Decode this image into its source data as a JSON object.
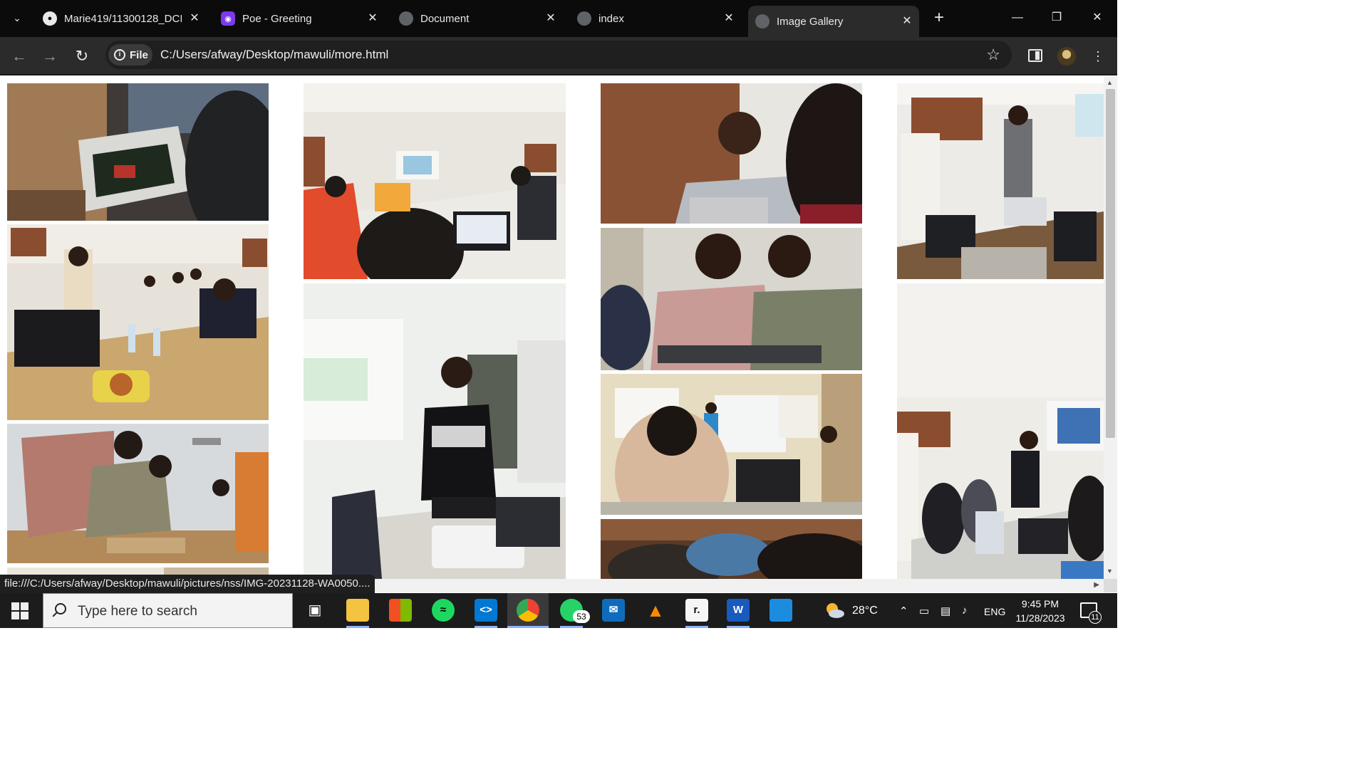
{
  "browser": {
    "tabs": [
      {
        "title": "Marie419/11300128_DCIT",
        "icon": "github-icon",
        "active": false
      },
      {
        "title": "Poe - Greeting",
        "icon": "poe-icon",
        "active": false
      },
      {
        "title": "Document",
        "icon": "globe-icon",
        "active": false
      },
      {
        "title": "index",
        "icon": "globe-icon",
        "active": false
      },
      {
        "title": "Image Gallery",
        "icon": "globe-icon",
        "active": true
      }
    ],
    "close_glyph": "✕",
    "new_tab_glyph": "+",
    "site_chip_label": "File",
    "url": "C:/Users/afway/Desktop/mawuli/more.html",
    "status_url": "file:///C:/Users/afway/Desktop/mawuli/pictures/nss/IMG-20231128-WA0050...."
  },
  "gallery": {
    "photos": [
      {
        "alt": "Hands working on an electronics kit board",
        "column": 1
      },
      {
        "alt": "Students seated at laptops in a workshop room with food on table",
        "column": 1
      },
      {
        "alt": "Participants assembling hardware kits on a table",
        "column": 1
      },
      {
        "alt": "Presenter at a projector screen facing a room of students",
        "column": 2
      },
      {
        "alt": "Student in GitHub Campus Expert jersey standing by a projector",
        "column": 2
      },
      {
        "alt": "Smiling facilitator at a laptop",
        "column": 3
      },
      {
        "alt": "Two participants working on a circuit together",
        "column": 3
      },
      {
        "alt": "Instructor writing on a whiteboard for seated students",
        "column": 3
      },
      {
        "alt": "Close-up of participants at a workbench",
        "column": 3
      },
      {
        "alt": "Presenter standing beside tables with kits and a laptop",
        "column": 4
      },
      {
        "alt": "Speaker addressing attendees in front of a projected slide",
        "column": 4
      }
    ]
  },
  "taskbar": {
    "search_placeholder": "Type here to search",
    "whatsapp_badge": "53",
    "temperature": "28°C",
    "language": "ENG",
    "time": "9:45 PM",
    "date": "11/28/2023",
    "notification_count": "11",
    "apps": [
      "task-view-icon",
      "file-explorer-icon",
      "microsoft-store-icon",
      "spotify-icon",
      "vscode-icon",
      "chrome-icon",
      "whatsapp-icon",
      "mail-icon",
      "vlc-icon",
      "replit-icon",
      "word-icon",
      "photos-icon"
    ]
  },
  "colors": {
    "tabbar_bg": "#0b0b0b",
    "toolbar_bg": "#2b2b2b",
    "taskbar_bg": "#1c1c1c",
    "page_bg": "#ffffff"
  }
}
